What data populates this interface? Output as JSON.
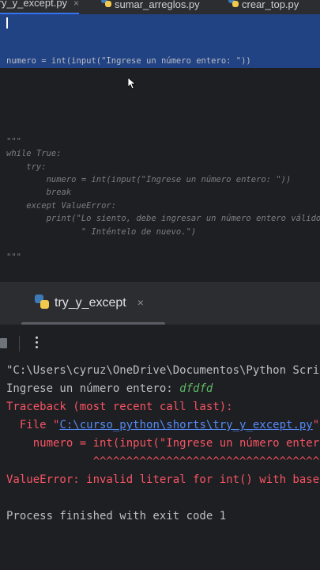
{
  "tabs": [
    {
      "label": "try_y_except.py",
      "active": true,
      "close": "×"
    },
    {
      "label": "sumar_arreglos.py",
      "active": false
    },
    {
      "label": "crear_top.py",
      "active": false
    }
  ],
  "editor": {
    "selected_line": "numero = int(input(\"Ingrese un número entero: \"))",
    "lines": [
      "\"\"\"",
      "while True:",
      "    try:",
      "        numero = int(input(\"Ingrese un número entero: \"))",
      "        break",
      "    except ValueError:",
      "        print(\"Lo siento, debe ingresar un número entero válido.\"+",
      "               \" Inténtelo de nuevo.\")",
      "\"\"\""
    ]
  },
  "run_panel": {
    "tab_label": "try_y_except",
    "close": "×"
  },
  "console": {
    "command": "\"C:\\Users\\cyruz\\OneDrive\\Documentos\\Python Scrip",
    "prompt": "Ingrese un número entero: ",
    "user_input": "dfdfd",
    "traceback_header": "Traceback (most recent call last):",
    "file_prefix": "  File \"",
    "file_path": "C:\\curso_python\\shorts\\try_y_except.py",
    "file_suffix": "\"",
    "code_line": "    numero = int(input(\"Ingrese un número entero",
    "caret_line": "             ^^^^^^^^^^^^^^^^^^^^^^^^^^^^^^^^^^^^",
    "error": "ValueError: invalid literal for int() with base",
    "exit_message": "Process finished with exit code 1"
  },
  "colors": {
    "selection": "#214283",
    "error": "#f75464",
    "link": "#548af7",
    "input": "#5fb865"
  }
}
